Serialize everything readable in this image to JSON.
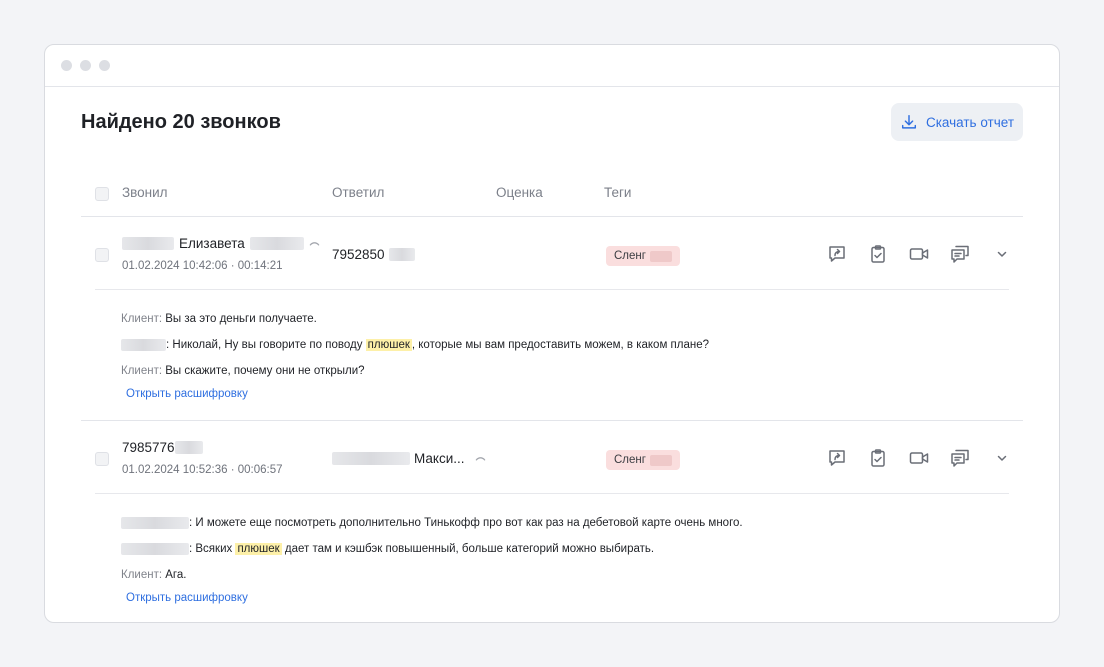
{
  "page": {
    "title": "Найдено 20 звонков",
    "download_label": "Скачать отчет"
  },
  "table": {
    "columns": {
      "caller": "Звонил",
      "answered": "Ответил",
      "rating": "Оценка",
      "tags": "Теги"
    }
  },
  "calls": [
    {
      "caller_name": "Елизавета",
      "caller_meta": "01.02.2024 10:42:06 · 00:14:21",
      "answered": "7952850",
      "tag": "Сленг",
      "lines": [
        {
          "speaker": "Клиент:",
          "text": "Вы за это деньги получаете."
        },
        {
          "speaker": "",
          "before": ": Николай, Ну вы говорите по поводу ",
          "mark": "плюшек",
          "after": ", которые мы вам предоставить можем, в каком плане?"
        },
        {
          "speaker": "Клиент:",
          "text": "Вы скажите, почему они не открыли?"
        }
      ],
      "link": "Открыть расшифровку"
    },
    {
      "caller_name": "7985776",
      "caller_meta": "01.02.2024 10:52:36 · 00:06:57",
      "answered": "Макси...",
      "tag": "Сленг",
      "lines": [
        {
          "speaker": "",
          "text": ": И можете еще посмотреть дополнительно Тинькофф про вот как раз на дебетовой карте очень много."
        },
        {
          "speaker": "",
          "before": ": Всяких ",
          "mark": "плюшек",
          "after": " дает там и кэшбэк повышенный, больше категорий можно выбирать."
        },
        {
          "speaker": "Клиент:",
          "text": "Ага."
        }
      ],
      "link": "Открыть расшифровку"
    }
  ],
  "icons": {
    "download": "download-icon",
    "share": "share-icon",
    "checklist": "clipboard-check-icon",
    "video": "video-icon",
    "chat": "chat-icon",
    "expand": "chevron-down-icon",
    "phone": "phone-icon"
  },
  "colors": {
    "accent": "#2f6fe0",
    "tag_bg": "#fadede",
    "highlight": "#fdf0a8"
  }
}
